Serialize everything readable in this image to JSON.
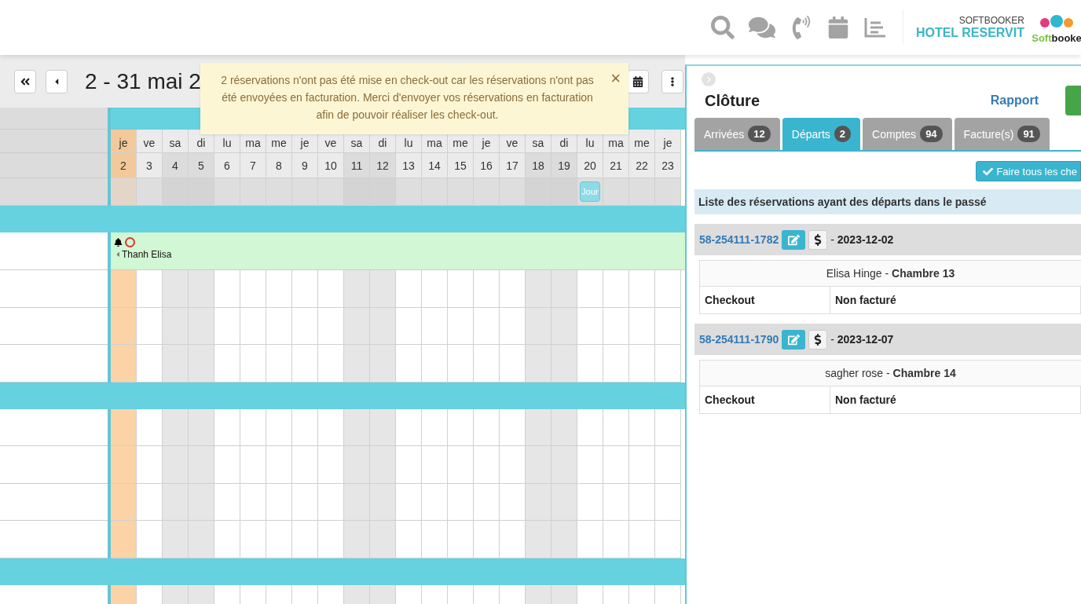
{
  "header": {
    "brand_small": "SOFTBOOKER",
    "brand_name": "HOTEL RESERVIT",
    "logo": {
      "part_1": "Soft",
      "part_2": "booke"
    }
  },
  "calendar": {
    "title": "2 - 31 mai 2",
    "days": [
      {
        "name": "je",
        "number": "2",
        "weekend": false,
        "today": true
      },
      {
        "name": "ve",
        "number": "3",
        "weekend": false,
        "today": false
      },
      {
        "name": "sa",
        "number": "4",
        "weekend": true,
        "today": false
      },
      {
        "name": "di",
        "number": "5",
        "weekend": true,
        "today": false
      },
      {
        "name": "lu",
        "number": "6",
        "weekend": false,
        "today": false
      },
      {
        "name": "ma",
        "number": "7",
        "weekend": false,
        "today": false
      },
      {
        "name": "me",
        "number": "8",
        "weekend": false,
        "today": false
      },
      {
        "name": "je",
        "number": "9",
        "weekend": false,
        "today": false
      },
      {
        "name": "ve",
        "number": "10",
        "weekend": false,
        "today": false
      },
      {
        "name": "sa",
        "number": "11",
        "weekend": true,
        "today": false
      },
      {
        "name": "di",
        "number": "12",
        "weekend": true,
        "today": false
      },
      {
        "name": "lu",
        "number": "13",
        "weekend": false,
        "today": false
      },
      {
        "name": "ma",
        "number": "14",
        "weekend": false,
        "today": false
      },
      {
        "name": "me",
        "number": "15",
        "weekend": false,
        "today": false
      },
      {
        "name": "je",
        "number": "16",
        "weekend": false,
        "today": false
      },
      {
        "name": "ve",
        "number": "17",
        "weekend": false,
        "today": false
      },
      {
        "name": "sa",
        "number": "18",
        "weekend": true,
        "today": false
      },
      {
        "name": "di",
        "number": "19",
        "weekend": true,
        "today": false
      },
      {
        "name": "lu",
        "number": "20",
        "weekend": false,
        "today": false,
        "button": "Jour"
      },
      {
        "name": "ma",
        "number": "21",
        "weekend": false,
        "today": false
      },
      {
        "name": "me",
        "number": "22",
        "weekend": false,
        "today": false
      },
      {
        "name": "je",
        "number": "23",
        "weekend": false,
        "today": false
      }
    ],
    "rows": [
      {
        "kind": "band"
      },
      {
        "kind": "booking",
        "guest": "Thanh Elisa"
      },
      {
        "kind": "empty"
      },
      {
        "kind": "empty"
      },
      {
        "kind": "empty"
      },
      {
        "kind": "band"
      },
      {
        "kind": "empty"
      },
      {
        "kind": "empty"
      },
      {
        "kind": "empty"
      },
      {
        "kind": "empty"
      },
      {
        "kind": "band"
      },
      {
        "kind": "empty"
      }
    ]
  },
  "toast": {
    "message": "2 réservations n'ont pas été mise en check-out car les réservations n'ont pas été envoyées en facturation. Merci d'envoyer vos réservations en facturation afin de pouvoir réaliser les check-out.",
    "close": "×"
  },
  "panel": {
    "title": "Clôture",
    "report_link": "Rapport",
    "tabs": [
      {
        "label": "Arrivées",
        "count": "12",
        "selected": false
      },
      {
        "label": "Départs",
        "count": "2",
        "selected": true
      },
      {
        "label": "Comptes",
        "count": "94",
        "selected": false
      },
      {
        "label": "Facture(s)",
        "count": "91",
        "selected": false
      }
    ],
    "action_button": "Faire tous les che",
    "separator": "-",
    "list_title": "Liste des réservations ayant des départs dans le passé",
    "reservations": [
      {
        "number": "58-254111-1782",
        "date": "2023-12-02",
        "guest": "Elisa Hinge",
        "room": "Chambre 13",
        "status_1": "Checkout",
        "status_2": "Non facturé"
      },
      {
        "number": "58-254111-1790",
        "date": "2023-12-07",
        "guest": "sagher rose",
        "room": "Chambre 14",
        "status_1": "Checkout",
        "status_2": "Non facturé"
      }
    ]
  }
}
